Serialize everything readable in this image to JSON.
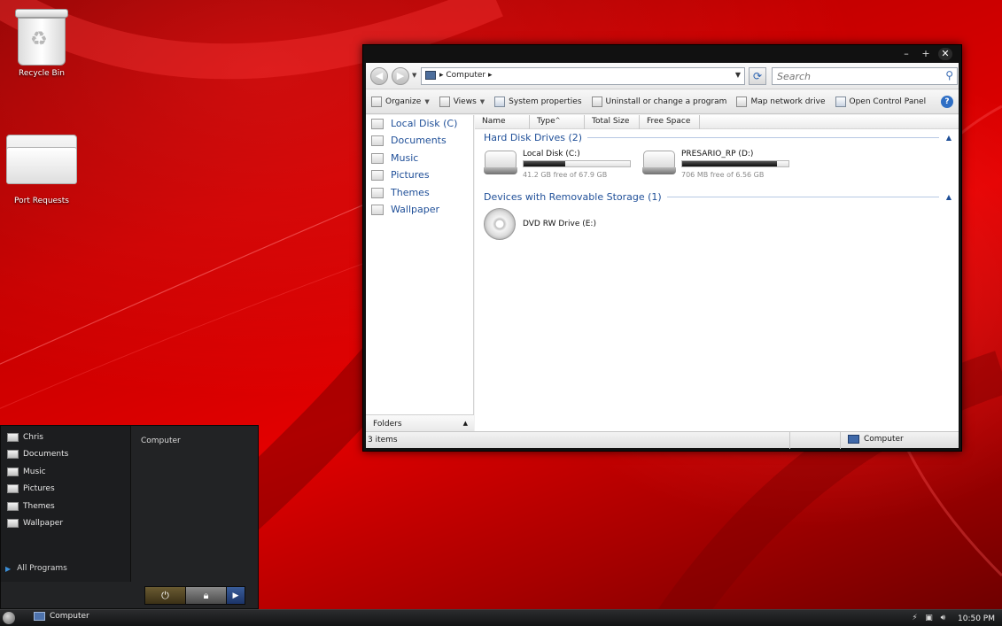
{
  "desktop": {
    "icons": [
      {
        "label": "Recycle Bin",
        "icon": "recycle-bin-icon"
      },
      {
        "label": "Port Requests",
        "icon": "folder-icon"
      }
    ]
  },
  "window": {
    "address": {
      "crumb": "Computer"
    },
    "search": {
      "placeholder": "Search"
    },
    "toolbar": {
      "organize": "Organize",
      "views": "Views",
      "system_properties": "System properties",
      "uninstall": "Uninstall or change a program",
      "map_drive": "Map network drive",
      "control_panel": "Open Control Panel",
      "help": "?"
    },
    "nav": [
      {
        "label": "Local Disk (C)",
        "icon": "drive-icon"
      },
      {
        "label": "Documents",
        "icon": "documents-icon"
      },
      {
        "label": "Music",
        "icon": "music-icon"
      },
      {
        "label": "Pictures",
        "icon": "pictures-icon"
      },
      {
        "label": "Themes",
        "icon": "themes-icon"
      },
      {
        "label": "Wallpaper",
        "icon": "wallpaper-icon"
      }
    ],
    "folders_label": "Folders",
    "columns": [
      "Name",
      "Type",
      "Total Size",
      "Free Space"
    ],
    "groups": {
      "hdd": "Hard Disk Drives (2)",
      "removable": "Devices with Removable Storage (1)"
    },
    "drives": [
      {
        "name": "Local Disk (C:)",
        "free_text": "41.2 GB free of 67.9 GB",
        "used_fraction": 0.39
      },
      {
        "name": "PRESARIO_RP (D:)",
        "free_text": "706 MB free of 6.56 GB",
        "used_fraction": 0.89
      }
    ],
    "removable": [
      {
        "name": "DVD RW Drive (E:)",
        "icon": "dvd-icon"
      }
    ],
    "status": {
      "items": "3 items",
      "location": "Computer"
    }
  },
  "start_menu": {
    "items": [
      {
        "label": "Chris",
        "icon": "user-folder-icon"
      },
      {
        "label": "Documents",
        "icon": "documents-icon"
      },
      {
        "label": "Music",
        "icon": "music-icon"
      },
      {
        "label": "Pictures",
        "icon": "pictures-icon"
      },
      {
        "label": "Themes",
        "icon": "themes-icon"
      },
      {
        "label": "Wallpaper",
        "icon": "wallpaper-icon"
      }
    ],
    "all_programs": "All Programs",
    "right_place": "Computer"
  },
  "taskbar": {
    "task_label": "Computer",
    "clock": "10:50 PM"
  }
}
